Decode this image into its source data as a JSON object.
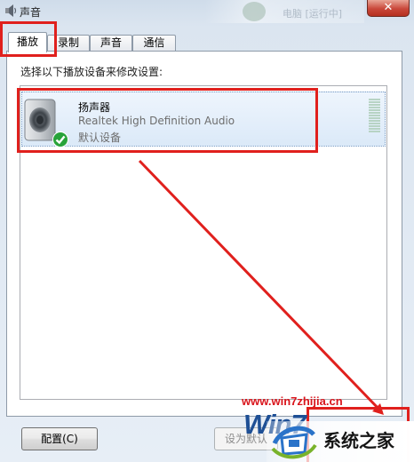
{
  "window": {
    "title": "声音",
    "close_label": "✕"
  },
  "background": {
    "blurred_text": "电脑 [运行中]"
  },
  "tabs": [
    {
      "label": "播放",
      "active": true
    },
    {
      "label": "录制",
      "active": false
    },
    {
      "label": "声音",
      "active": false
    },
    {
      "label": "通信",
      "active": false
    }
  ],
  "instruction": "选择以下播放设备来修改设置:",
  "device": {
    "name": "扬声器",
    "driver": "Realtek High Definition Audio",
    "status": "默认设备",
    "icon": "speaker-icon",
    "status_icon": "green-check-icon"
  },
  "buttons": {
    "configure": "配置(C)",
    "set_default": "设为默认"
  },
  "watermark": {
    "site": "www.win7zhijia.cn",
    "brand": "Win7",
    "name": "系统之家"
  },
  "colors": {
    "annotation": "#e0201d",
    "accent": "#3a7bd5",
    "check": "#27a33a"
  }
}
